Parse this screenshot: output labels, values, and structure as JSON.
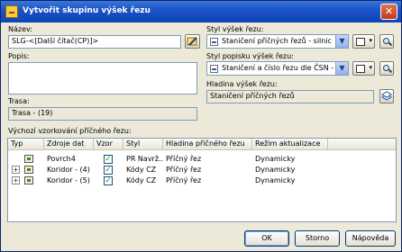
{
  "dialog": {
    "title": "Vytvořit skupinu výšek řezu",
    "close_label": "✕"
  },
  "name": {
    "label": "Název:",
    "value": "SLG-<[Další čítač(CP)]>"
  },
  "description": {
    "label": "Popis:",
    "value": ""
  },
  "alignment": {
    "label": "Trasa:",
    "value": "Trasa - (19)"
  },
  "section_view_style": {
    "label": "Styl výšek řezu:",
    "value": "Staničení příčných řezů - silnic"
  },
  "label_style": {
    "label": "Styl popisku výšek řezu:",
    "value": "Staničení a číslo řezu dle ČSN - VLEV("
  },
  "layer": {
    "label": "Hladina výšek řezu:",
    "value": "Staničení příčných řezů"
  },
  "sample_lines": {
    "section_label": "Výchozí vzorkování příčného řezu:",
    "columns": [
      "Typ",
      "Zdroje dat",
      "Vzor",
      "Styl",
      "Hladina příčného řezu",
      "Režim aktualizace"
    ],
    "rows": [
      {
        "source": "Povrch4",
        "sample": true,
        "style": "PR Navrž...",
        "layer": "Příčný řez",
        "mode": "Dynamicky",
        "expander": ""
      },
      {
        "source": "Koridor - (4)",
        "sample": true,
        "style": "Kódy CZ",
        "layer": "Příčný řez",
        "mode": "Dynamicky",
        "expander": "+"
      },
      {
        "source": "Koridor - (5)",
        "sample": true,
        "style": "Kódy CZ",
        "layer": "Příčný řez",
        "mode": "Dynamicky",
        "expander": "+"
      }
    ]
  },
  "buttons": {
    "ok": "OK",
    "cancel": "Storno",
    "help": "Nápověda"
  }
}
